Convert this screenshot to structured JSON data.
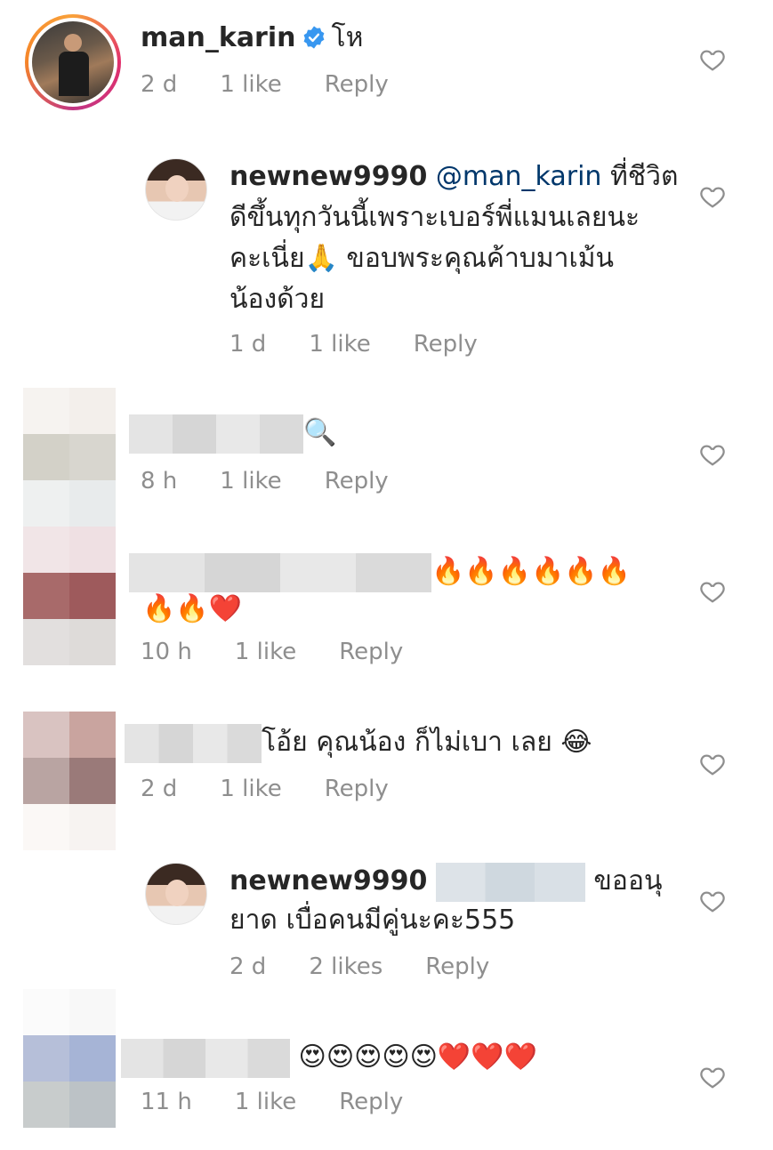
{
  "comments": [
    {
      "username": "man_karin",
      "verified": true,
      "text": "โห",
      "time": "2 d",
      "likes": "1 like",
      "reply": "Reply"
    },
    {
      "username": "newnew9990",
      "mention": "@man_karin",
      "text_line1": " ที่ชีวิต",
      "text_line2": "ดีขึ้นทุกวันนี้เพราะเบอร์พี่แมนเลยนะ",
      "text_line3_a": "คะเนี่ย",
      "text_line3_emoji": "🙏",
      "text_line3_b": " ขอบพระคุณค้าบมาเม้น",
      "text_line4": "น้องด้วย",
      "time": "1 d",
      "likes": "1 like",
      "reply": "Reply"
    },
    {
      "emoji": "🔍",
      "time": "8 h",
      "likes": "1 like",
      "reply": "Reply"
    },
    {
      "emoji_line1": "🔥🔥🔥🔥🔥🔥",
      "emoji_line2": "🔥🔥❤️",
      "time": "10 h",
      "likes": "1 like",
      "reply": "Reply"
    },
    {
      "text": "โอ้ย คุณน้อง ก็ไม่เบา เลย ",
      "emoji": "😂",
      "time": "2 d",
      "likes": "1 like",
      "reply": "Reply"
    },
    {
      "username": "newnew9990",
      "text_line1": " ขออนุ",
      "text_line2": "ยาด เบื่อคนมีคู่นะคะ555",
      "time": "2 d",
      "likes": "2 likes",
      "reply": "Reply"
    },
    {
      "emoji": "😍😍😍😍😍❤️❤️❤️",
      "time": "11 h",
      "likes": "1 like",
      "reply": "Reply"
    }
  ],
  "icons": {
    "heart": "heart-outline-icon",
    "verified": "verified-badge-icon"
  },
  "colors": {
    "verified": "#3897f0",
    "mention": "#00376b",
    "meta": "#8e8e8e",
    "heart_stroke": "#8e8e8e"
  }
}
